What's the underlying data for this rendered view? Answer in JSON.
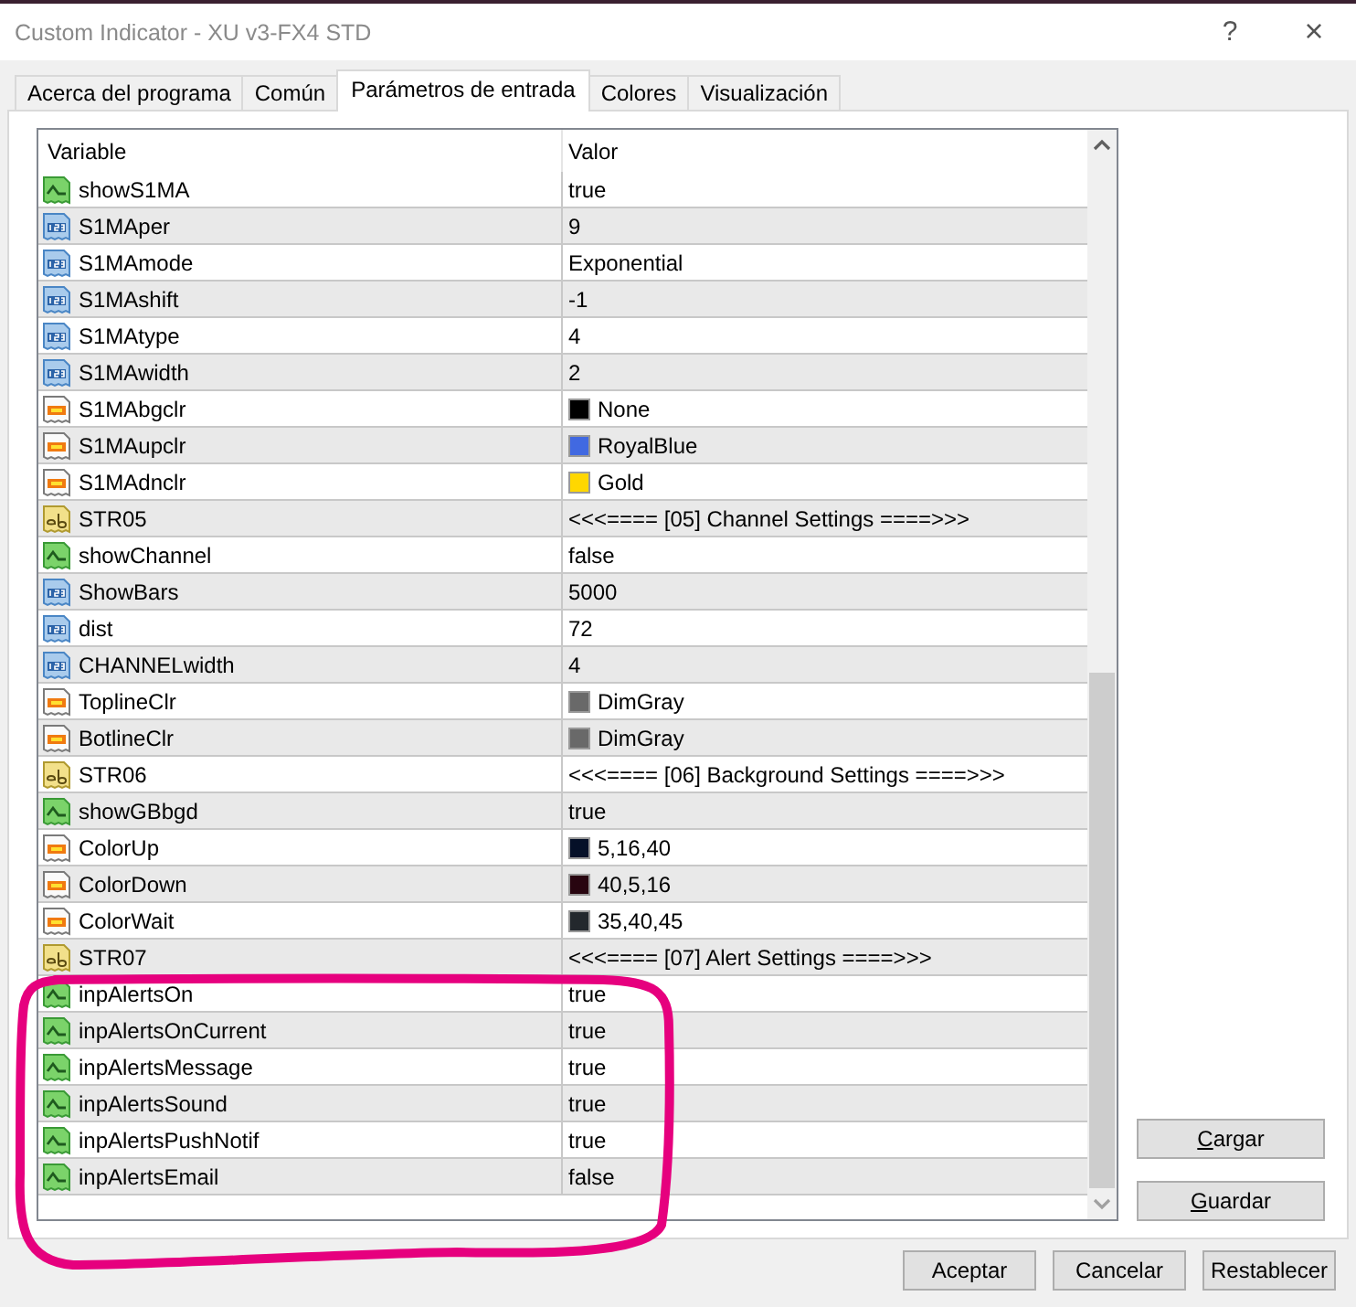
{
  "window": {
    "title": "Custom Indicator - XU v3-FX4 STD",
    "help_button": "?",
    "close_button": "×"
  },
  "tabs": [
    {
      "label": "Acerca del programa",
      "selected": false
    },
    {
      "label": "Común",
      "selected": false
    },
    {
      "label": "Parámetros de entrada",
      "selected": true
    },
    {
      "label": "Colores",
      "selected": false
    },
    {
      "label": "Visualización",
      "selected": false
    }
  ],
  "table": {
    "columns": [
      "Variable",
      "Valor"
    ],
    "rows": [
      {
        "kind": "bool",
        "name": "showS1MA",
        "value": "true"
      },
      {
        "kind": "number",
        "name": "S1MAper",
        "value": "9"
      },
      {
        "kind": "number",
        "name": "S1MAmode",
        "value": "Exponential"
      },
      {
        "kind": "number",
        "name": "S1MAshift",
        "value": "-1"
      },
      {
        "kind": "number",
        "name": "S1MAtype",
        "value": "4"
      },
      {
        "kind": "number",
        "name": "S1MAwidth",
        "value": "2"
      },
      {
        "kind": "color",
        "name": "S1MAbgclr",
        "value": "None",
        "color": "#000000"
      },
      {
        "kind": "color",
        "name": "S1MAupclr",
        "value": "RoyalBlue",
        "color": "#4169e1"
      },
      {
        "kind": "color",
        "name": "S1MAdnclr",
        "value": "Gold",
        "color": "#ffd700"
      },
      {
        "kind": "string",
        "name": "STR05",
        "value": "<<<==== [05] Channel Settings ====>>>"
      },
      {
        "kind": "bool",
        "name": "showChannel",
        "value": "false"
      },
      {
        "kind": "number",
        "name": "ShowBars",
        "value": "5000"
      },
      {
        "kind": "number",
        "name": "dist",
        "value": "72"
      },
      {
        "kind": "number",
        "name": "CHANNELwidth",
        "value": "4"
      },
      {
        "kind": "color",
        "name": "ToplineClr",
        "value": "DimGray",
        "color": "#696969"
      },
      {
        "kind": "color",
        "name": "BotlineClr",
        "value": "DimGray",
        "color": "#696969"
      },
      {
        "kind": "string",
        "name": "STR06",
        "value": "<<<==== [06] Background Settings ====>>>"
      },
      {
        "kind": "bool",
        "name": "showGBbgd",
        "value": "true"
      },
      {
        "kind": "color",
        "name": "ColorUp",
        "value": "5,16,40",
        "color": "#051028"
      },
      {
        "kind": "color",
        "name": "ColorDown",
        "value": "40,5,16",
        "color": "#280510"
      },
      {
        "kind": "color",
        "name": "ColorWait",
        "value": "35,40,45",
        "color": "#23282d"
      },
      {
        "kind": "string",
        "name": "STR07",
        "value": "<<<==== [07] Alert Settings ====>>>"
      },
      {
        "kind": "bool",
        "name": "inpAlertsOn",
        "value": "true"
      },
      {
        "kind": "bool",
        "name": "inpAlertsOnCurrent",
        "value": "true"
      },
      {
        "kind": "bool",
        "name": "inpAlertsMessage",
        "value": "true"
      },
      {
        "kind": "bool",
        "name": "inpAlertsSound",
        "value": "true"
      },
      {
        "kind": "bool",
        "name": "inpAlertsPushNotif",
        "value": "true"
      },
      {
        "kind": "bool",
        "name": "inpAlertsEmail",
        "value": "false"
      }
    ]
  },
  "side_buttons": [
    "Cargar",
    "Guardar"
  ],
  "buttons": [
    "Aceptar",
    "Cancelar",
    "Restablecer"
  ]
}
